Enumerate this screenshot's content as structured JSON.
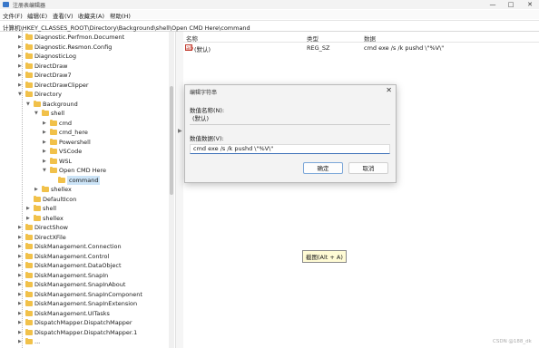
{
  "window": {
    "title": "注册表编辑器",
    "minimize": "—",
    "maximize": "□",
    "close": "✕"
  },
  "menu": [
    "文件(F)",
    "编辑(E)",
    "查看(V)",
    "收藏夹(A)",
    "帮助(H)"
  ],
  "address": "计算机\\HKEY_CLASSES_ROOT\\Directory\\Background\\shell\\Open CMD Here\\command",
  "tree": [
    {
      "label": "Diagnostic.Perfmon.Document",
      "depth": 0,
      "expand": "right"
    },
    {
      "label": "Diagnostic.Resmon.Config",
      "depth": 0,
      "expand": "right"
    },
    {
      "label": "DiagnosticLog",
      "depth": 0,
      "expand": "right"
    },
    {
      "label": "DirectDraw",
      "depth": 0,
      "expand": "right"
    },
    {
      "label": "DirectDraw7",
      "depth": 0,
      "expand": "right"
    },
    {
      "label": "DirectDrawClipper",
      "depth": 0,
      "expand": "right"
    },
    {
      "label": "Directory",
      "depth": 0,
      "expand": "down"
    },
    {
      "label": "Background",
      "depth": 1,
      "expand": "down"
    },
    {
      "label": "shell",
      "depth": 2,
      "expand": "down"
    },
    {
      "label": "cmd",
      "depth": 3,
      "expand": "right"
    },
    {
      "label": "cmd_here",
      "depth": 3,
      "expand": "right"
    },
    {
      "label": "Powershell",
      "depth": 3,
      "expand": "right"
    },
    {
      "label": "VSCode",
      "depth": 3,
      "expand": "right"
    },
    {
      "label": "WSL",
      "depth": 3,
      "expand": "right"
    },
    {
      "label": "Open CMD Here",
      "depth": 3,
      "expand": "down"
    },
    {
      "label": "command",
      "depth": 4,
      "expand": "none",
      "selected": true
    },
    {
      "label": "shellex",
      "depth": 2,
      "expand": "right"
    },
    {
      "label": "DefaultIcon",
      "depth": 1,
      "expand": "none"
    },
    {
      "label": "shell",
      "depth": 1,
      "expand": "right"
    },
    {
      "label": "shellex",
      "depth": 1,
      "expand": "right"
    },
    {
      "label": "DirectShow",
      "depth": 0,
      "expand": "right"
    },
    {
      "label": "DirectXFile",
      "depth": 0,
      "expand": "right"
    },
    {
      "label": "DiskManagement.Connection",
      "depth": 0,
      "expand": "right"
    },
    {
      "label": "DiskManagement.Control",
      "depth": 0,
      "expand": "right"
    },
    {
      "label": "DiskManagement.DataObject",
      "depth": 0,
      "expand": "right"
    },
    {
      "label": "DiskManagement.SnapIn",
      "depth": 0,
      "expand": "right"
    },
    {
      "label": "DiskManagement.SnapInAbout",
      "depth": 0,
      "expand": "right"
    },
    {
      "label": "DiskManagement.SnapInComponent",
      "depth": 0,
      "expand": "right"
    },
    {
      "label": "DiskManagement.SnapInExtension",
      "depth": 0,
      "expand": "right"
    },
    {
      "label": "DiskManagement.UITasks",
      "depth": 0,
      "expand": "right"
    },
    {
      "label": "DispatchMapper.DispatchMapper",
      "depth": 0,
      "expand": "right"
    },
    {
      "label": "DispatchMapper.DispatchMapper.1",
      "depth": 0,
      "expand": "right"
    },
    {
      "label": "...",
      "depth": 0,
      "expand": "right"
    }
  ],
  "columns": {
    "name": "名称",
    "type": "类型",
    "data": "数据"
  },
  "values": [
    {
      "name": "(默认)",
      "type": "REG_SZ",
      "data": "cmd exe /s /k pushd \\\"%V\\\"",
      "icon": "ab"
    }
  ],
  "dialog": {
    "title": "编辑字符串",
    "name_label": "数值名称(N):",
    "name_value": "(默认)",
    "data_label": "数值数据(V):",
    "data_value": "cmd exe /s /k pushd \\\"%V\\\"",
    "ok": "确定",
    "cancel": "取消",
    "close": "✕"
  },
  "tooltip": "截图(Alt + A)",
  "watermark": "CSDN @188_dk",
  "colors": {
    "accent": "#3a6fb7",
    "folder": "#f1c14a",
    "selection": "#cce4f7"
  }
}
